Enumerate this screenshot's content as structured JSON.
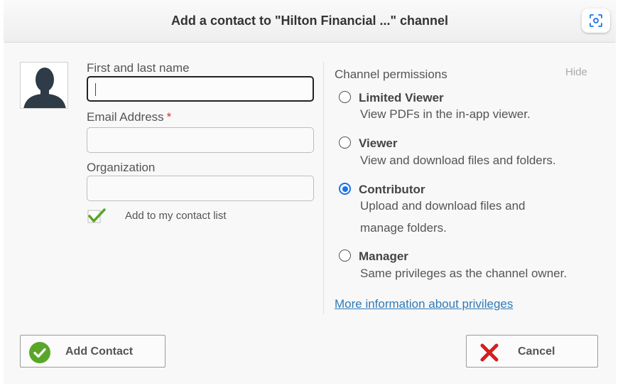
{
  "header": {
    "title": "Add a contact to \"Hilton Financial ...\" channel",
    "scan_icon": "scan-focus-icon"
  },
  "form": {
    "name_label": "First and last name",
    "name_value": "",
    "email_label": "Email Address",
    "email_required_mark": "*",
    "email_value": "",
    "org_label": "Organization",
    "org_value": "",
    "add_to_list_label": "Add to my contact list",
    "add_to_list_checked": true
  },
  "permissions": {
    "title": "Channel permissions",
    "hide_label": "Hide",
    "options": [
      {
        "name": "Limited Viewer",
        "description": "View PDFs in the in-app viewer.",
        "selected": false
      },
      {
        "name": "Viewer",
        "description": "View and download files and folders.",
        "selected": false
      },
      {
        "name": "Contributor",
        "description": "Upload and download files and manage folders.",
        "selected": true
      },
      {
        "name": "Manager",
        "description": "Same privileges as the channel owner.",
        "selected": false
      }
    ],
    "more_info_link": "More information about privileges"
  },
  "footer": {
    "add_label": "Add Contact",
    "cancel_label": "Cancel"
  },
  "colors": {
    "accent": "#1a73e8",
    "link": "#2f7ab8",
    "required": "#d0342c",
    "success": "#5aa62a",
    "danger": "#d31f1f"
  }
}
